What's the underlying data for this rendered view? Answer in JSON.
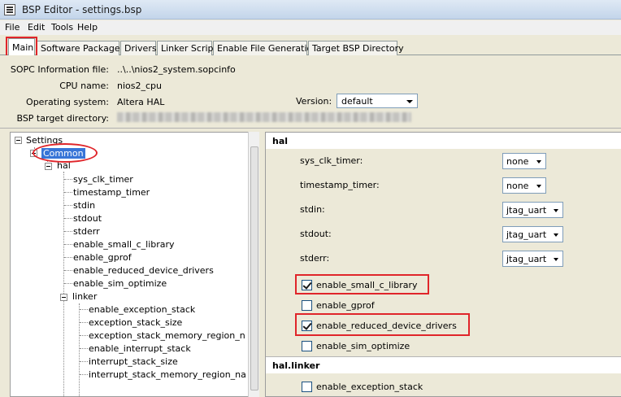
{
  "window": {
    "title": "BSP Editor - settings.bsp"
  },
  "menu": [
    "File",
    "Edit",
    "Tools",
    "Help"
  ],
  "tabs": [
    "Main",
    "Software Packages",
    "Drivers",
    "Linker Script",
    "Enable File Generation",
    "Target BSP Directory"
  ],
  "info": {
    "sopc_label": "SOPC Information file:",
    "sopc_value": "..\\..\\nios2_system.sopcinfo",
    "cpu_label": "CPU name:",
    "cpu_value": "nios2_cpu",
    "os_label": "Operating system:",
    "os_value": "Altera HAL",
    "version_label": "Version:",
    "version_value": "default",
    "target_label": "BSP target directory:"
  },
  "tree": {
    "settings": "Settings",
    "common": "Common",
    "hal": "hal",
    "hal_items": [
      "sys_clk_timer",
      "timestamp_timer",
      "stdin",
      "stdout",
      "stderr",
      "enable_small_c_library",
      "enable_gprof",
      "enable_reduced_device_drivers",
      "enable_sim_optimize"
    ],
    "linker": "linker",
    "linker_items": [
      "enable_exception_stack",
      "exception_stack_size",
      "exception_stack_memory_region_n",
      "enable_interrupt_stack",
      "interrupt_stack_size",
      "interrupt_stack_memory_region_na"
    ]
  },
  "settings": {
    "hal_header": "hal",
    "combos": [
      {
        "label": "sys_clk_timer:",
        "value": "none"
      },
      {
        "label": "timestamp_timer:",
        "value": "none"
      },
      {
        "label": "stdin:",
        "value": "jtag_uart"
      },
      {
        "label": "stdout:",
        "value": "jtag_uart"
      },
      {
        "label": "stderr:",
        "value": "jtag_uart"
      }
    ],
    "checkboxes": [
      {
        "label": "enable_small_c_library",
        "checked": true
      },
      {
        "label": "enable_gprof",
        "checked": false
      },
      {
        "label": "enable_reduced_device_drivers",
        "checked": true
      },
      {
        "label": "enable_sim_optimize",
        "checked": false
      }
    ],
    "linker_header": "hal.linker",
    "linker_checkboxes": [
      {
        "label": "enable_exception_stack",
        "checked": false
      }
    ]
  },
  "colors": {
    "highlight": "#e0252a",
    "selection": "#3875d7"
  }
}
